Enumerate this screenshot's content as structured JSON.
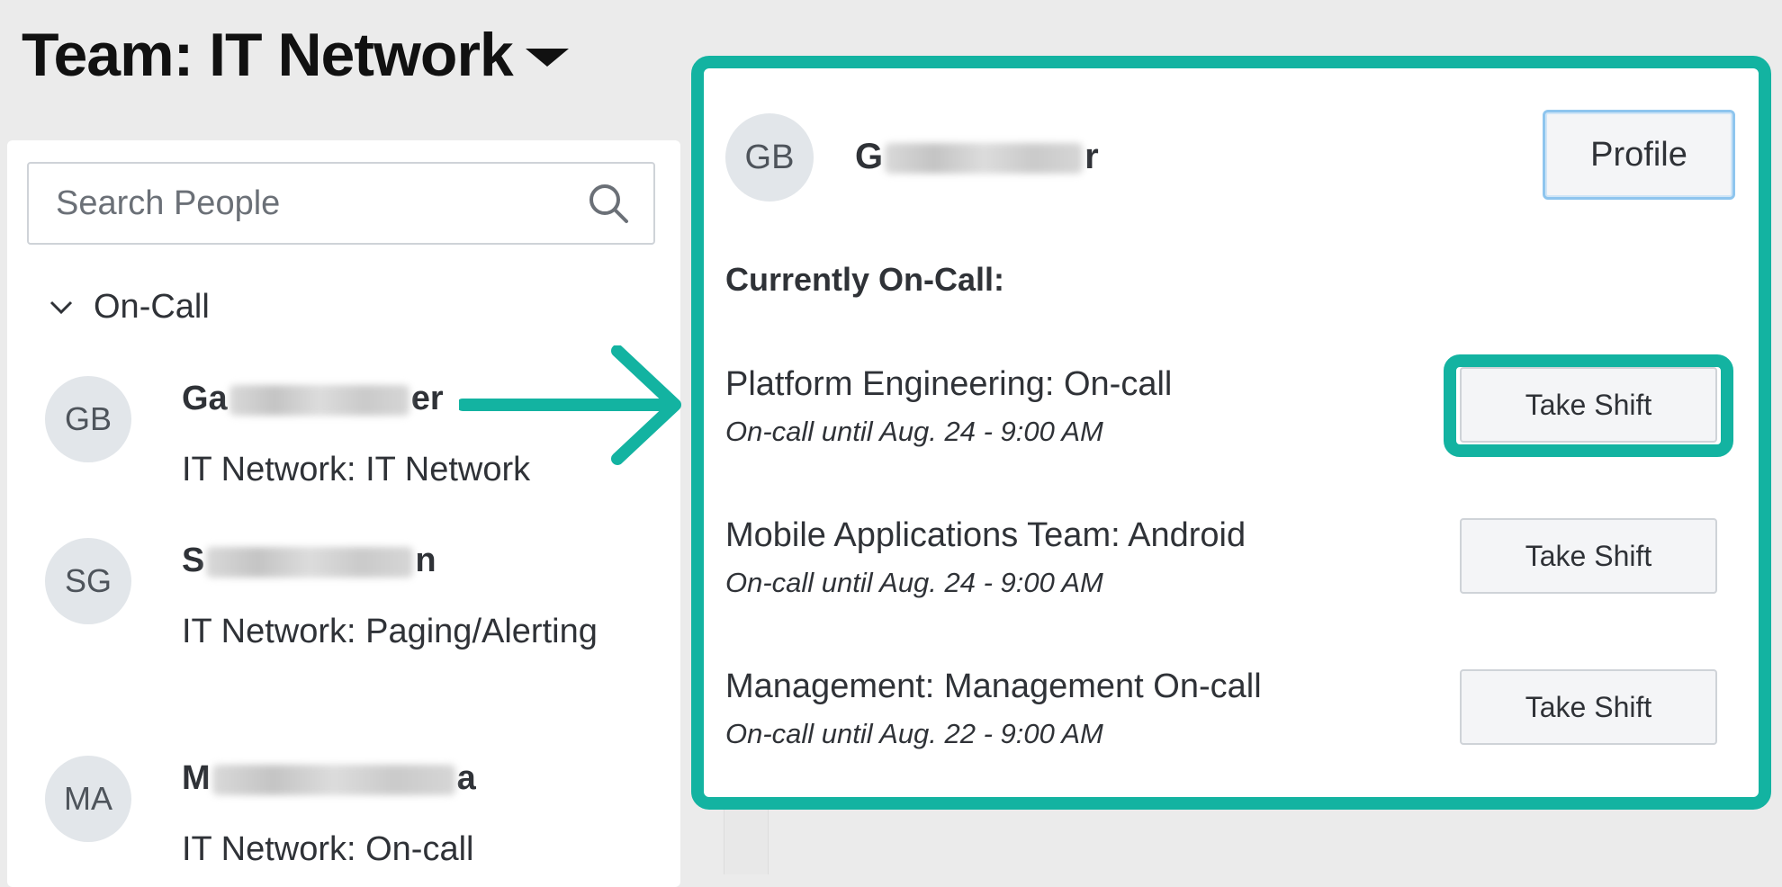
{
  "header": {
    "team_title": "Team: IT Network"
  },
  "search": {
    "placeholder": "Search People"
  },
  "section": {
    "label": "On-Call"
  },
  "people": [
    {
      "initials": "GB",
      "name_start": "Ga",
      "name_end": "er",
      "role": "IT Network: IT Network"
    },
    {
      "initials": "SG",
      "name_start": "S",
      "name_end": "n",
      "role": "IT Network: Paging/Alerting"
    },
    {
      "initials": "MA",
      "name_start": "M",
      "name_end": "a",
      "role": "IT Network: On-call"
    }
  ],
  "popover": {
    "initials": "GB",
    "name_start": "G",
    "name_end": "r",
    "profile_label": "Profile",
    "currently_label": "Currently On-Call:",
    "shifts": [
      {
        "title": "Platform Engineering: On-call",
        "until": "On-call until Aug. 24 - 9:00 AM",
        "button": "Take Shift"
      },
      {
        "title": "Mobile Applications Team: Android",
        "until": "On-call until Aug. 24 - 9:00 AM",
        "button": "Take Shift"
      },
      {
        "title": "Management: Management On-call",
        "until": "On-call until Aug. 22 - 9:00 AM",
        "button": "Take Shift"
      }
    ]
  },
  "colors": {
    "accent": "#13b3a1",
    "avatar_bg": "#e2e6ea",
    "page_bg": "#ebebeb"
  }
}
